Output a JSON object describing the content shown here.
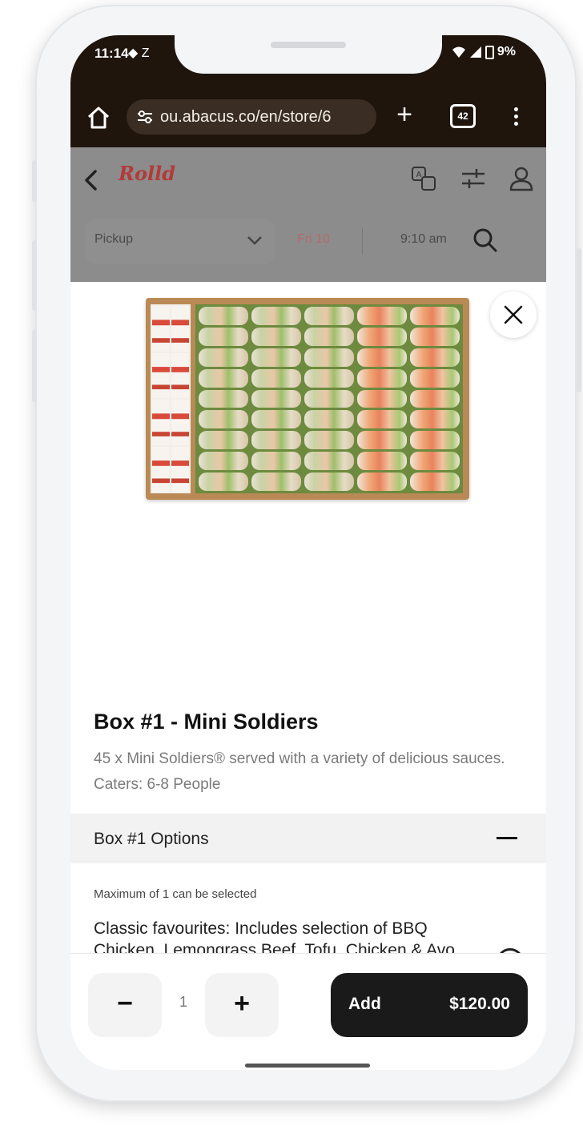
{
  "status_bar": {
    "time": "11:14",
    "left_icons": "◆ Z",
    "battery": "9%"
  },
  "browser": {
    "url": "ou.abacus.co/en/store/6",
    "tab_count": "42"
  },
  "store_header": {
    "logo_text": "Rolld"
  },
  "order_bar": {
    "mode": "Pickup",
    "day": "Fri 10",
    "time": "9:10 am"
  },
  "item": {
    "title": "Box #1 - Mini Soldiers",
    "description": "45 x Mini Soldiers® served with a variety of delicious sauces. Caters: 6-8 People"
  },
  "options": {
    "section_title": "Box #1 Options",
    "max_note": "Maximum of 1 can be selected",
    "choices": [
      {
        "label": "Classic favourites: Includes selection of BBQ Chicken, Lemongrass Beef, Tofu, Chicken & Avo, Garlic Prawn"
      }
    ]
  },
  "cart": {
    "quantity": "1",
    "add_label": "Add",
    "price": "$120.00"
  },
  "icons": {
    "home": "home-icon",
    "site_settings": "tune-icon",
    "new_tab": "plus-icon",
    "tabs": "tabs-icon",
    "menu": "more-vert-icon",
    "back": "chevron-left-icon",
    "translate": "translate-icon",
    "filters": "sliders-icon",
    "account": "user-icon",
    "dropdown": "chevron-down-icon",
    "search": "search-icon",
    "close": "close-icon"
  }
}
